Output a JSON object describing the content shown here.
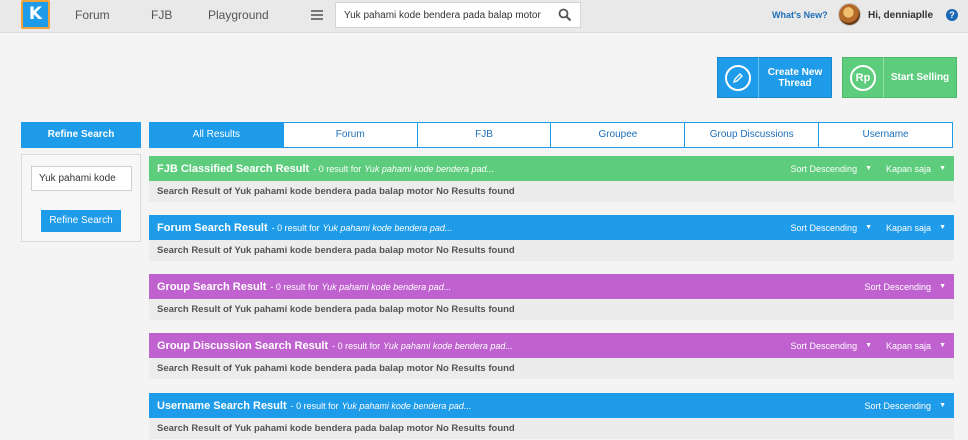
{
  "colors": {
    "primary": "#1e9be9",
    "fjb_green": "#5dcc7c",
    "group_purple": "#c061d0",
    "accent_orange": "#f0a23b"
  },
  "header": {
    "logo_icon": "kaskus-logo-icon",
    "nav": [
      "Forum",
      "FJB",
      "Playground"
    ],
    "menu_icon": "hamburger-icon",
    "search_value": "Yuk pahami kode bendera pada balap motor",
    "search_icon": "search-icon",
    "whats_new": "What's New?",
    "greeting": "Hi, denniaplle",
    "help": "?"
  },
  "actions": {
    "create_label_1": "Create New",
    "create_label_2": "Thread",
    "create_icon": "pencil-icon",
    "sell_label": "Start Selling",
    "sell_icon": "rupiah-icon",
    "sell_icon_text": "Rp"
  },
  "sidebar": {
    "title": "Refine Search",
    "input_value": "Yuk pahami kode",
    "button": "Refine Search"
  },
  "tabs": [
    "All Results",
    "Forum",
    "FJB",
    "Groupee",
    "Group Discussions",
    "Username"
  ],
  "sections": [
    {
      "title": "FJB Classified Search Result",
      "count_text": "- 0 result for",
      "query": "Yuk pahami kode bendera pad...",
      "sort": "Sort Descending",
      "time": "Kapan saja",
      "body": "Search Result of Yuk pahami kode bendera pada balap motor No Results found"
    },
    {
      "title": "Forum Search Result",
      "count_text": "- 0 result for",
      "query": "Yuk pahami kode bendera pad...",
      "sort": "Sort Descending",
      "time": "Kapan saja",
      "body": "Search Result of Yuk pahami kode bendera pada balap motor No Results found"
    },
    {
      "title": "Group Search Result",
      "count_text": "- 0 result for",
      "query": "Yuk pahami kode bendera pad...",
      "sort": "Sort Descending",
      "body": "Search Result of Yuk pahami kode bendera pada balap motor No Results found"
    },
    {
      "title": "Group Discussion Search Result",
      "count_text": "- 0 result for",
      "query": "Yuk pahami kode bendera pad...",
      "sort": "Sort Descending",
      "time": "Kapan saja",
      "body": "Search Result of Yuk pahami kode bendera pada balap motor No Results found"
    },
    {
      "title": "Username Search Result",
      "count_text": "- 0 result for",
      "query": "Yuk pahami kode bendera pad...",
      "sort": "Sort Descending",
      "body": "Search Result of Yuk pahami kode bendera pada balap motor No Results found"
    }
  ]
}
